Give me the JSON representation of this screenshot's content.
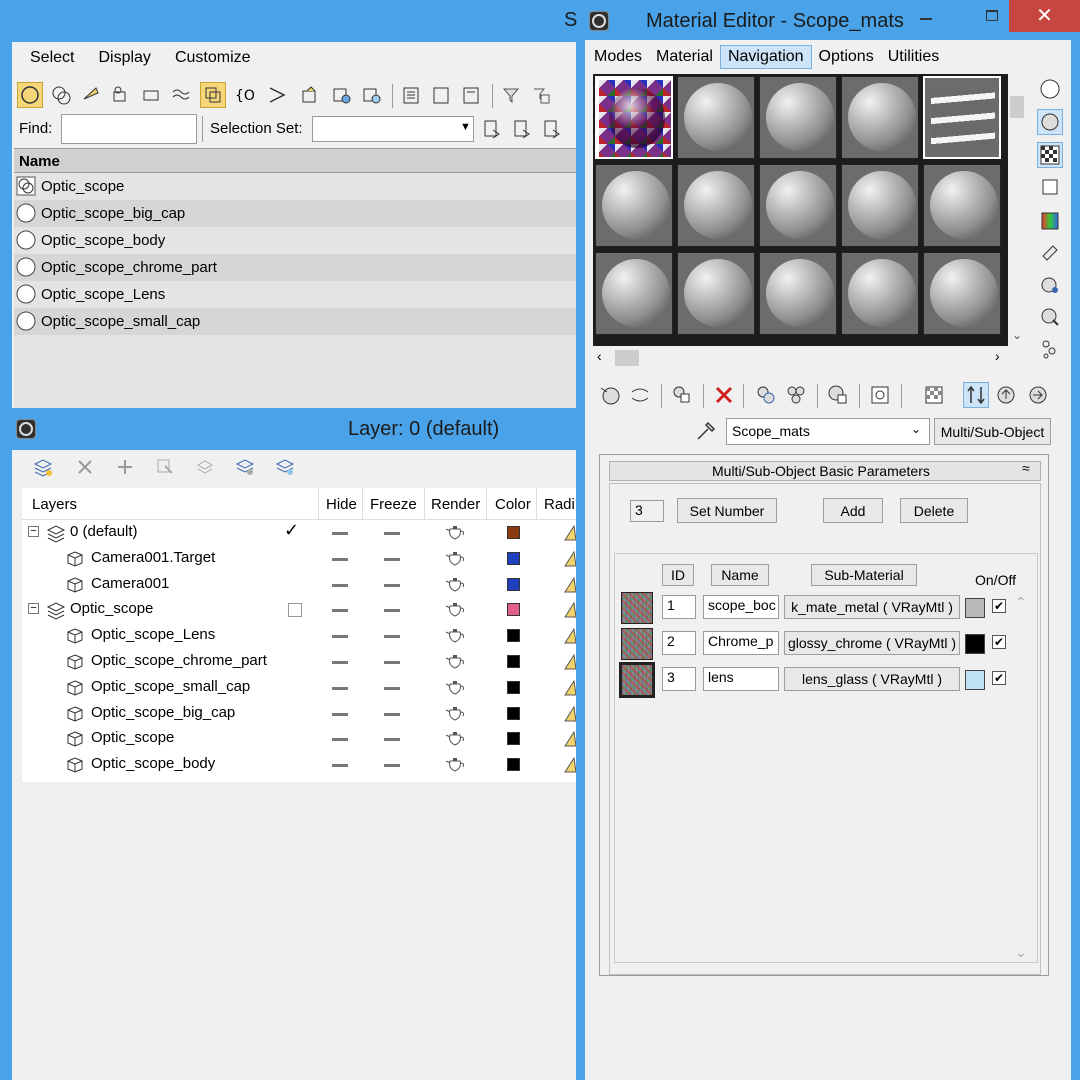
{
  "scene_explorer": {
    "title_fragment": "S",
    "menu": [
      "Select",
      "Display",
      "Customize"
    ],
    "find_label": "Find:",
    "find_value": "",
    "selection_set_label": "Selection Set:",
    "selection_set_value": "",
    "column_name": "Name",
    "rows": [
      "Optic_scope",
      "Optic_scope_big_cap",
      "Optic_scope_body",
      "Optic_scope_chrome_part",
      "Optic_scope_Lens",
      "Optic_scope_small_cap"
    ]
  },
  "layer_window": {
    "title": "Layer: 0 (default)",
    "columns": [
      "Layers",
      "Hide",
      "Freeze",
      "Render",
      "Color",
      "Radi"
    ],
    "rows": [
      {
        "name": "0 (default)",
        "level": 0,
        "type": "layer",
        "check": "checked",
        "color": "#8b3a10"
      },
      {
        "name": "Camera001.Target",
        "level": 1,
        "type": "object",
        "check": "",
        "color": "#1f3fbf"
      },
      {
        "name": "Camera001",
        "level": 1,
        "type": "object",
        "check": "",
        "color": "#1f3fbf"
      },
      {
        "name": "Optic_scope",
        "level": 0,
        "type": "layer",
        "check": "empty",
        "color": "#e0608a"
      },
      {
        "name": "Optic_scope_Lens",
        "level": 1,
        "type": "object",
        "check": "",
        "color": "#000000"
      },
      {
        "name": "Optic_scope_chrome_part",
        "level": 1,
        "type": "object",
        "check": "",
        "color": "#000000"
      },
      {
        "name": "Optic_scope_small_cap",
        "level": 1,
        "type": "object",
        "check": "",
        "color": "#000000"
      },
      {
        "name": "Optic_scope_big_cap",
        "level": 1,
        "type": "object",
        "check": "",
        "color": "#000000"
      },
      {
        "name": "Optic_scope",
        "level": 1,
        "type": "object",
        "check": "",
        "color": "#000000"
      },
      {
        "name": "Optic_scope_body",
        "level": 1,
        "type": "object",
        "check": "",
        "color": "#000000"
      }
    ]
  },
  "material_editor": {
    "title": "Material Editor - Scope_mats",
    "menu": [
      "Modes",
      "Material",
      "Navigation",
      "Options",
      "Utilities"
    ],
    "material_name": "Scope_mats",
    "material_type": "Multi/Sub-Object",
    "rollout_title": "Multi/Sub-Object Basic Parameters",
    "number_value": "3",
    "set_number_label": "Set Number",
    "add_label": "Add",
    "delete_label": "Delete",
    "col_id": "ID",
    "col_name": "Name",
    "col_submaterial": "Sub-Material",
    "col_onoff": "On/Off",
    "sub_materials": [
      {
        "id": "1",
        "name": "scope_boc",
        "material": "k_mate_metal  ( VRayMtl )",
        "color": "#b9b9b9",
        "on": "✔"
      },
      {
        "id": "2",
        "name": "Chrome_p",
        "material": "glossy_chrome  ( VRayMtl )",
        "color": "#000000",
        "on": "✔"
      },
      {
        "id": "3",
        "name": "lens",
        "material": "lens_glass  ( VRayMtl )",
        "color": "#bde3f2",
        "on": "✔"
      }
    ]
  }
}
